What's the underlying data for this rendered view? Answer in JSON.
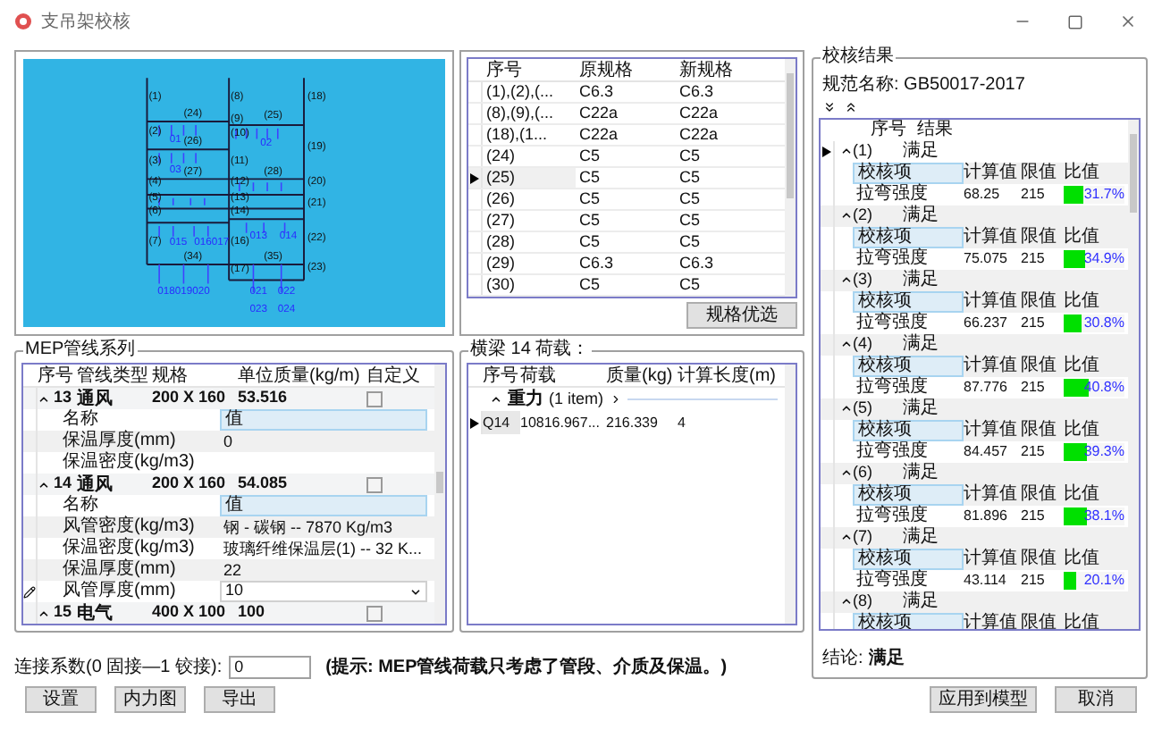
{
  "window": {
    "title": "支吊架校核"
  },
  "canvas": {
    "labels": [
      {
        "text": "(1)",
        "kind": "member"
      },
      {
        "text": "(2)",
        "kind": "member"
      },
      {
        "text": "(3)",
        "kind": "member"
      },
      {
        "text": "(4)",
        "kind": "member"
      },
      {
        "text": "(5)",
        "kind": "member"
      },
      {
        "text": "(6)",
        "kind": "member"
      },
      {
        "text": "(7)",
        "kind": "member"
      },
      {
        "text": "(8)",
        "kind": "member"
      },
      {
        "text": "(9)",
        "kind": "member"
      },
      {
        "text": "(10)",
        "kind": "member"
      },
      {
        "text": "(11)",
        "kind": "member"
      },
      {
        "text": "(12)",
        "kind": "member"
      },
      {
        "text": "(13)",
        "kind": "member"
      },
      {
        "text": "(14)",
        "kind": "member"
      },
      {
        "text": "(16)",
        "kind": "member"
      },
      {
        "text": "(17)",
        "kind": "member"
      },
      {
        "text": "(18)",
        "kind": "member"
      },
      {
        "text": "(19)",
        "kind": "member"
      },
      {
        "text": "(20)",
        "kind": "member"
      },
      {
        "text": "(21)",
        "kind": "member"
      },
      {
        "text": "(22)",
        "kind": "member"
      },
      {
        "text": "(23)",
        "kind": "member"
      },
      {
        "text": "(24)",
        "kind": "member"
      },
      {
        "text": "(25)",
        "kind": "member"
      },
      {
        "text": "(26)",
        "kind": "member"
      },
      {
        "text": "(27)",
        "kind": "member"
      },
      {
        "text": "(28)",
        "kind": "member"
      },
      {
        "text": "(34)",
        "kind": "member"
      },
      {
        "text": "(35)",
        "kind": "member"
      },
      {
        "text": "01",
        "kind": "pipe"
      },
      {
        "text": "02",
        "kind": "pipe"
      },
      {
        "text": "03",
        "kind": "pipe"
      },
      {
        "text": "015",
        "kind": "pipe"
      },
      {
        "text": "016017",
        "kind": "pipe"
      },
      {
        "text": "013",
        "kind": "pipe"
      },
      {
        "text": "014",
        "kind": "pipe"
      },
      {
        "text": "018019020",
        "kind": "pipe"
      },
      {
        "text": "021",
        "kind": "pipe"
      },
      {
        "text": "022",
        "kind": "pipe"
      },
      {
        "text": "023",
        "kind": "pipe"
      },
      {
        "text": "024",
        "kind": "pipe"
      }
    ]
  },
  "spec_table": {
    "columns": [
      "序号",
      "原规格",
      "新规格"
    ],
    "rows": [
      {
        "cells": [
          "(1),(2),(...",
          "C6.3",
          "C6.3"
        ],
        "selected": false
      },
      {
        "cells": [
          "(8),(9),(...",
          "C22a",
          "C22a"
        ],
        "selected": false
      },
      {
        "cells": [
          "(18),(1...",
          "C22a",
          "C22a"
        ],
        "selected": false
      },
      {
        "cells": [
          "(24)",
          "C5",
          "C5"
        ],
        "selected": false
      },
      {
        "cells": [
          "(25)",
          "C5",
          "C5"
        ],
        "selected": true
      },
      {
        "cells": [
          "(26)",
          "C5",
          "C5"
        ],
        "selected": false
      },
      {
        "cells": [
          "(27)",
          "C5",
          "C5"
        ],
        "selected": false
      },
      {
        "cells": [
          "(28)",
          "C5",
          "C5"
        ],
        "selected": false
      },
      {
        "cells": [
          "(29)",
          "C6.3",
          "C6.3"
        ],
        "selected": false
      },
      {
        "cells": [
          "(30)",
          "C5",
          "C5"
        ],
        "selected": false
      }
    ],
    "button": "规格优选"
  },
  "mep": {
    "title": "MEP管线系列",
    "columns": [
      "序号",
      "管线类型",
      "规格",
      "单位质量(kg/m)",
      "自定义"
    ],
    "rows": [
      {
        "index": "13",
        "type": "通风",
        "size": "200 X 160",
        "unit_mass": "53.516",
        "custom": false,
        "expanded": true,
        "properties": [
          {
            "name": "名称",
            "value": "值",
            "kind": "header",
            "editing": false
          },
          {
            "name": "保温厚度(mm)",
            "value": "0",
            "kind": "text",
            "editing": false
          },
          {
            "name": "保温密度(kg/m3)",
            "kind": "text",
            "editing": false
          }
        ]
      },
      {
        "index": "14",
        "type": "通风",
        "size": "200 X 160",
        "unit_mass": "54.085",
        "custom": false,
        "expanded": true,
        "properties": [
          {
            "name": "名称",
            "value": "值",
            "kind": "header",
            "editing": false
          },
          {
            "name": "风管密度(kg/m3)",
            "value": "钢 - 碳钢 -- 7870 Kg/m3",
            "kind": "text",
            "editing": false
          },
          {
            "name": "保温密度(kg/m3)",
            "value": "玻璃纤维保温层(1) -- 32 K...",
            "kind": "text",
            "editing": false
          },
          {
            "name": "保温厚度(mm)",
            "value": "22",
            "kind": "text",
            "editing": false
          },
          {
            "name": "风管厚度(mm)",
            "value": "10",
            "kind": "dropdown",
            "editing": true
          }
        ]
      },
      {
        "index": "15",
        "type": "电气",
        "size": "400 X 100",
        "unit_mass": "100",
        "custom": false,
        "expanded": true
      }
    ]
  },
  "loads": {
    "title": "横梁 14 荷载：",
    "columns": [
      "序号",
      "荷载",
      "质量(kg)",
      "计算长度(m)"
    ],
    "groups": [
      {
        "name": "重力",
        "count": "(1 item)",
        "expanded": true,
        "rows": [
          {
            "cells": [
              "Q14",
              "10816.967...",
              "216.339",
              "4"
            ],
            "selected": true
          }
        ]
      }
    ]
  },
  "connection": {
    "label": "连接系数(0 固接—1 铰接):",
    "value": "0",
    "hint": "(提示: MEP管线荷载只考虑了管段、介质及保温。)"
  },
  "check_results": {
    "title": "校核结果",
    "code": "规范名称: GB50017-2017",
    "columns": [
      "序号",
      "结果"
    ],
    "groups": [
      {
        "index": "(1)",
        "result": "满足",
        "expanded": true,
        "selected": true,
        "item_columns": [
          "校核项",
          "计算值",
          "限值",
          "比值"
        ],
        "items": [
          {
            "name": "拉弯强度",
            "value": "68.25",
            "limit": "215",
            "ratio": "31.7%",
            "level": 0.317
          }
        ]
      },
      {
        "index": "(2)",
        "result": "满足",
        "expanded": true,
        "selected": false,
        "item_columns": [
          "校核项",
          "计算值",
          "限值",
          "比值"
        ],
        "items": [
          {
            "name": "拉弯强度",
            "value": "75.075",
            "limit": "215",
            "ratio": "34.9%",
            "level": 0.349
          }
        ]
      },
      {
        "index": "(3)",
        "result": "满足",
        "expanded": true,
        "selected": false,
        "item_columns": [
          "校核项",
          "计算值",
          "限值",
          "比值"
        ],
        "items": [
          {
            "name": "拉弯强度",
            "value": "66.237",
            "limit": "215",
            "ratio": "30.8%",
            "level": 0.308
          }
        ]
      },
      {
        "index": "(4)",
        "result": "满足",
        "expanded": true,
        "selected": false,
        "item_columns": [
          "校核项",
          "计算值",
          "限值",
          "比值"
        ],
        "items": [
          {
            "name": "拉弯强度",
            "value": "87.776",
            "limit": "215",
            "ratio": "40.8%",
            "level": 0.408
          }
        ]
      },
      {
        "index": "(5)",
        "result": "满足",
        "expanded": true,
        "selected": false,
        "item_columns": [
          "校核项",
          "计算值",
          "限值",
          "比值"
        ],
        "items": [
          {
            "name": "拉弯强度",
            "value": "84.457",
            "limit": "215",
            "ratio": "39.3%",
            "level": 0.393
          }
        ]
      },
      {
        "index": "(6)",
        "result": "满足",
        "expanded": true,
        "selected": false,
        "item_columns": [
          "校核项",
          "计算值",
          "限值",
          "比值"
        ],
        "items": [
          {
            "name": "拉弯强度",
            "value": "81.896",
            "limit": "215",
            "ratio": "38.1%",
            "level": 0.381
          }
        ]
      },
      {
        "index": "(7)",
        "result": "满足",
        "expanded": true,
        "selected": false,
        "item_columns": [
          "校核项",
          "计算值",
          "限值",
          "比值"
        ],
        "items": [
          {
            "name": "拉弯强度",
            "value": "43.114",
            "limit": "215",
            "ratio": "20.1%",
            "level": 0.201
          }
        ]
      },
      {
        "index": "(8)",
        "result": "满足",
        "expanded": true,
        "selected": false,
        "item_columns": [
          "校核项",
          "计算值",
          "限值",
          "比值"
        ]
      }
    ],
    "conclusion_label": "结论:",
    "conclusion": "满足"
  },
  "buttons_left": [
    "设置",
    "内力图",
    "导出"
  ],
  "buttons_right": [
    "应用到模型",
    "取消"
  ]
}
